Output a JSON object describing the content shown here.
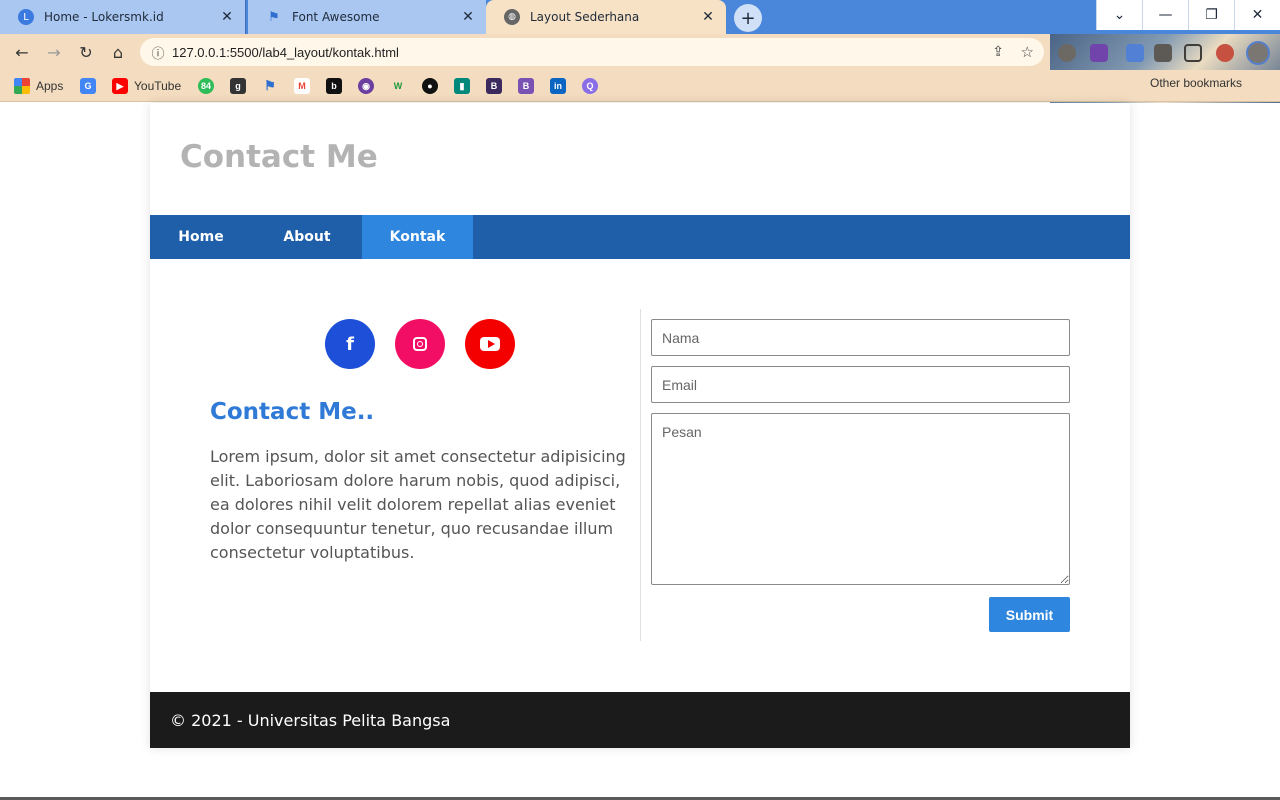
{
  "browser": {
    "tabs": [
      {
        "title": "Home - Lokersmk.id",
        "favicon": "lokersmk-icon"
      },
      {
        "title": "Font Awesome",
        "favicon": "flag-icon"
      },
      {
        "title": "Layout Sederhana",
        "favicon": "globe-icon",
        "active": true
      }
    ],
    "url": "127.0.0.1:5500/lab4_layout/kontak.html",
    "bookmarks": [
      {
        "label": "Apps",
        "icon": "apps-grid-icon"
      },
      {
        "label": "",
        "icon": "google-translate-icon"
      },
      {
        "label": "YouTube",
        "icon": "youtube-icon"
      },
      {
        "label": "",
        "icon": "app-84-icon"
      },
      {
        "label": "",
        "icon": "g-icon"
      },
      {
        "label": "",
        "icon": "flag-icon"
      },
      {
        "label": "",
        "icon": "gmail-icon"
      },
      {
        "label": "",
        "icon": "b-icon"
      },
      {
        "label": "",
        "icon": "tor-icon"
      },
      {
        "label": "",
        "icon": "w-icon"
      },
      {
        "label": "",
        "icon": "github-icon"
      },
      {
        "label": "",
        "icon": "meet-icon"
      },
      {
        "label": "",
        "icon": "b-purple-icon"
      },
      {
        "label": "",
        "icon": "bootstrap-icon"
      },
      {
        "label": "",
        "icon": "linkedin-icon"
      },
      {
        "label": "",
        "icon": "q-icon"
      }
    ],
    "other_bookmarks": "Other bookmarks"
  },
  "page": {
    "site_title": "Contact Me",
    "nav": [
      "Home",
      "About",
      "Kontak"
    ],
    "active_nav": "Kontak",
    "contact_heading": "Contact Me..",
    "contact_text": "Lorem ipsum, dolor sit amet consectetur adipisicing elit. Laboriosam dolore harum nobis, quod adipisci, ea dolores nihil velit dolorem repellat alias eveniet dolor consequuntur tenetur, quo recusandae illum consectetur voluptatibus.",
    "social": [
      "facebook-icon",
      "instagram-icon",
      "youtube-icon"
    ],
    "form": {
      "nama_placeholder": "Nama",
      "email_placeholder": "Email",
      "pesan_placeholder": "Pesan",
      "submit_label": "Submit"
    },
    "footer": "© 2021 - Universitas Pelita Bangsa"
  },
  "colors": {
    "nav_bg": "#1f5faa",
    "nav_active": "#2e86de",
    "heading_blue": "#2e7ad6",
    "facebook": "#1d4fd8",
    "instagram": "#f20e64",
    "youtube": "#f50000",
    "footer_bg": "#1b1b1b"
  }
}
